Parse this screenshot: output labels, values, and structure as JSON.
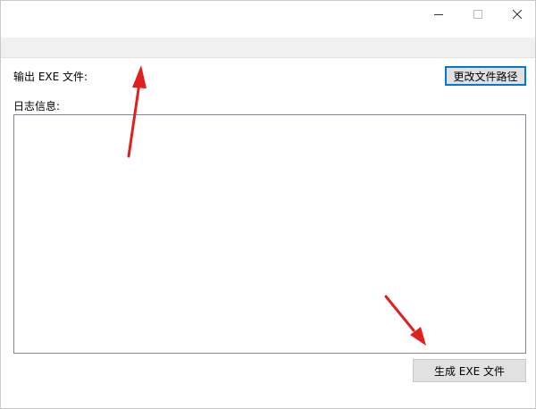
{
  "window": {
    "minimize_glyph": "—",
    "maximize_glyph": "☐",
    "close_glyph": "✕"
  },
  "main": {
    "output_label": "输出 EXE 文件:",
    "change_path_button": "更改文件路径",
    "log_label": "日志信息:",
    "log_text": "",
    "generate_button": "生成 EXE 文件"
  },
  "annotations": {
    "arrow_color": "#e02020"
  }
}
